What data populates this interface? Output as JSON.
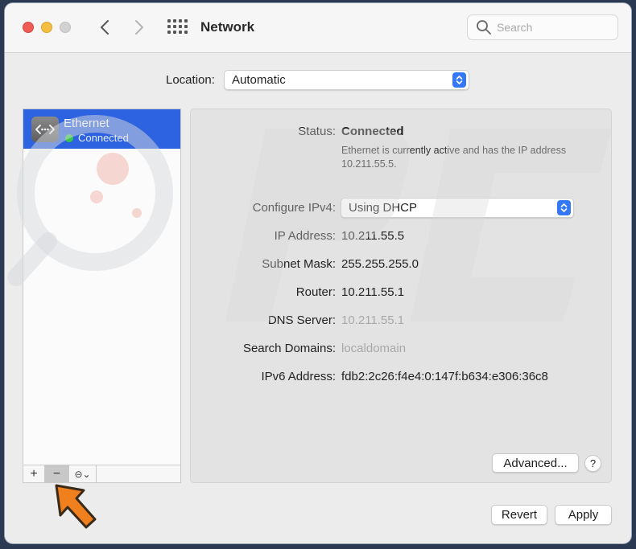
{
  "window": {
    "title": "Network"
  },
  "search": {
    "placeholder": "Search"
  },
  "location": {
    "label": "Location:",
    "value": "Automatic"
  },
  "sidebar": {
    "services": [
      {
        "name": "Ethernet",
        "status": "Connected",
        "status_color": "#34c84a"
      }
    ],
    "buttons": {
      "add": "+",
      "remove": "−",
      "action": "⊝⌄"
    }
  },
  "details": {
    "status": {
      "label": "Status:",
      "value": "Connected"
    },
    "description": "Ethernet is currently active and has the IP address 10.211.55.5.",
    "configure_ipv4": {
      "label": "Configure IPv4:",
      "value": "Using DHCP"
    },
    "ip_address": {
      "label": "IP Address:",
      "value": "10.211.55.5"
    },
    "subnet_mask": {
      "label": "Subnet Mask:",
      "value": "255.255.255.0"
    },
    "router": {
      "label": "Router:",
      "value": "10.211.55.1"
    },
    "dns_server": {
      "label": "DNS Server:",
      "value": "10.211.55.1"
    },
    "search_domains": {
      "label": "Search Domains:",
      "value": "localdomain"
    },
    "ipv6_address": {
      "label": "IPv6 Address:",
      "value": "fdb2:2c26:f4e4:0:147f:b634:e306:36c8"
    },
    "advanced_label": "Advanced...",
    "help_label": "?"
  },
  "footer": {
    "revert_label": "Revert",
    "apply_label": "Apply"
  },
  "colors": {
    "accent": "#2d63e0",
    "arrow": "#f07f1e"
  }
}
